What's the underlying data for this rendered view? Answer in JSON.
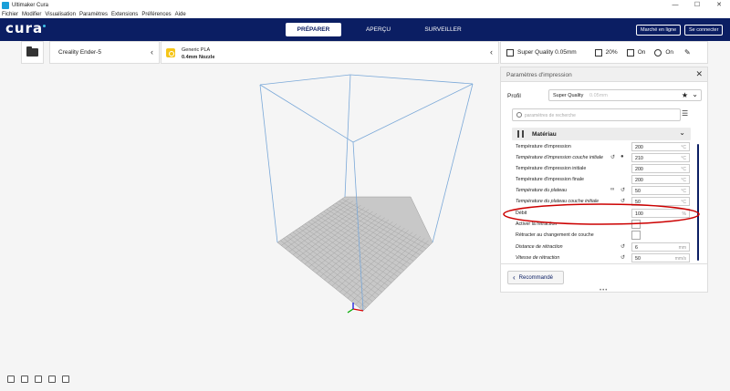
{
  "window": {
    "title": "Ultimaker Cura",
    "controls": [
      "—",
      "☐",
      "✕"
    ]
  },
  "menu": [
    "Fichier",
    "Modifier",
    "Visualisation",
    "Paramètres",
    "Extensions",
    "Préférences",
    "Aide"
  ],
  "header": {
    "logo": "cura",
    "stages": [
      "PRÉPARER",
      "APERÇU",
      "SURVEILLER"
    ],
    "marketplace": "Marché en ligne",
    "signin": "Se connecter"
  },
  "machine": {
    "name": "Creality Ender-5"
  },
  "material": {
    "line1": "Generic PLA",
    "line2": "0.4mm Nozzle"
  },
  "print_summary": {
    "profile": "Super Quality 0.05mm",
    "infill": "20%",
    "support": "On",
    "adhesion": "On"
  },
  "panel": {
    "title": "Paramètres d'impression",
    "profile_label": "Profil",
    "profile_value": "Super Quality",
    "profile_detail": "0.05mm",
    "search_placeholder": "paramètres de recherche",
    "category": "Matériau",
    "rows": [
      {
        "label": "Température d'impression",
        "value": "200",
        "unit": "°C"
      },
      {
        "label": "Température d'impression couche initiale",
        "value": "210",
        "unit": "°C"
      },
      {
        "label": "Température d'impression initiale",
        "value": "200",
        "unit": "°C"
      },
      {
        "label": "Température d'impression finale",
        "value": "200",
        "unit": "°C"
      },
      {
        "label": "Température du plateau",
        "value": "50",
        "unit": "°C"
      },
      {
        "label": "Température du plateau couche initiale",
        "value": "50",
        "unit": "°C"
      },
      {
        "label": "Débit",
        "value": "100",
        "unit": "%"
      },
      {
        "label": "Activer la rétraction"
      },
      {
        "label": "Rétracter au changement de couche"
      },
      {
        "label": "Distance de rétraction",
        "value": "6",
        "unit": "mm"
      },
      {
        "label": "Vitesse de rétraction",
        "value": "50",
        "unit": "mm/s"
      }
    ],
    "recommended_button": "Recommandé"
  },
  "colors": {
    "header": "#0b1e63",
    "highlight": "#cc0000",
    "build_volume": "#7aa8d8"
  }
}
